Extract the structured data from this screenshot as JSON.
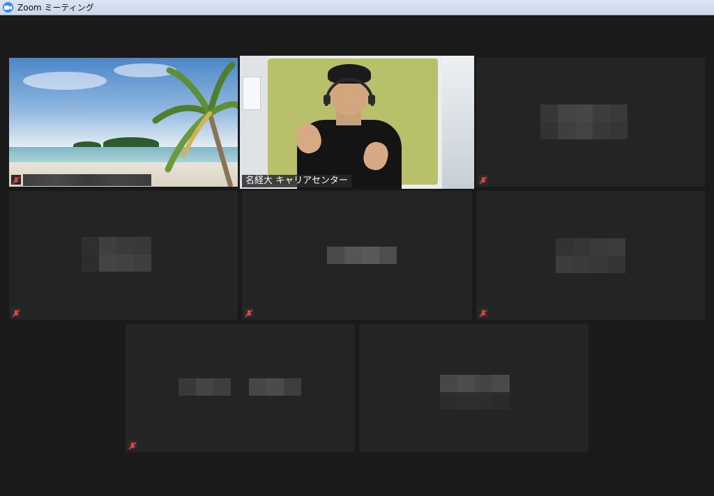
{
  "window": {
    "title": "Zoom ミーティング",
    "icon": "zoom-camera-icon"
  },
  "colors": {
    "background": "#1a1a1a",
    "tile": "#242424",
    "active_speaker_border": "#e6f23a",
    "mute_icon": "#e04343",
    "title_bar": "#c8d7ea"
  },
  "participants": [
    {
      "id": "p1",
      "label": "",
      "muted": true,
      "video": "beach-virtual-background"
    },
    {
      "id": "p2",
      "label": "名経大 キャリアセンター",
      "muted": false,
      "video": "webcam",
      "active_speaker": true
    },
    {
      "id": "p3",
      "label": "",
      "muted": true,
      "video": "off"
    },
    {
      "id": "p4",
      "label": "",
      "muted": true,
      "video": "off"
    },
    {
      "id": "p5",
      "label": "",
      "muted": true,
      "video": "off"
    },
    {
      "id": "p6",
      "label": "",
      "muted": true,
      "video": "off"
    },
    {
      "id": "p7",
      "label": "",
      "muted": true,
      "video": "off"
    },
    {
      "id": "p8",
      "label": "",
      "muted": false,
      "video": "off"
    }
  ]
}
